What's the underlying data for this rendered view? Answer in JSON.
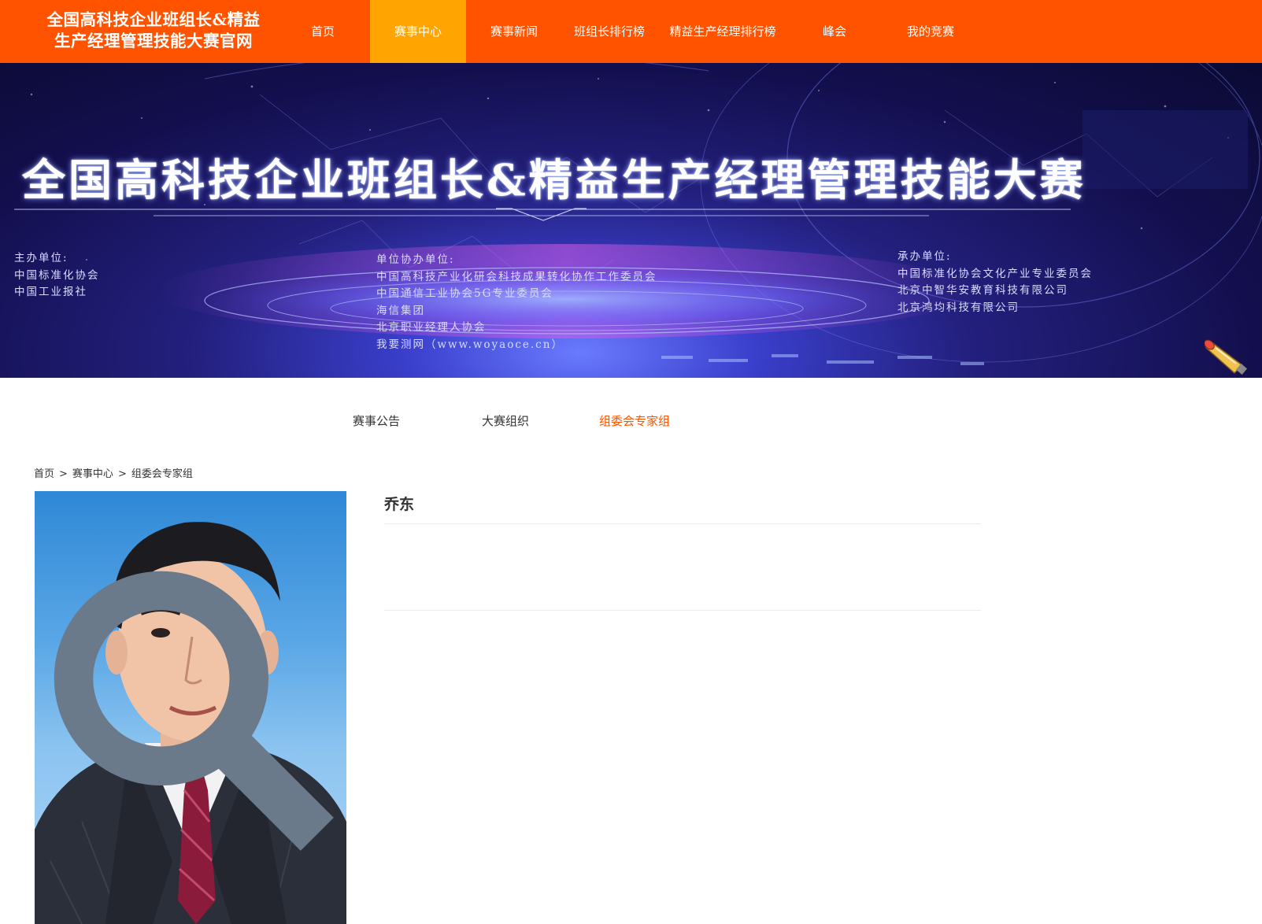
{
  "site": {
    "logo_line1": "全国高科技企业班组长&精益",
    "logo_line2": "生产经理管理技能大赛官网"
  },
  "nav": {
    "items": [
      {
        "label": "首页",
        "active": false
      },
      {
        "label": "赛事中心",
        "active": true
      },
      {
        "label": "赛事新闻",
        "active": false
      },
      {
        "label": "班组长排行榜",
        "active": false
      },
      {
        "label": "精益生产经理排行榜",
        "active": false
      },
      {
        "label": "峰会",
        "active": false
      },
      {
        "label": "我的竞赛",
        "active": false
      }
    ]
  },
  "banner": {
    "title": "全国高科技企业班组长&精益生产经理管理技能大赛",
    "host": [
      "主办单位:",
      "中国标准化协会",
      "中国工业报社"
    ],
    "co_organizers": [
      "单位协办单位:",
      "中国高科技产业化研会科技成果转化协作工作委员会",
      "中国通信工业协会5G专业委员会",
      "海信集团",
      "北京职业经理人协会",
      "我要测网（www.woyaoce.cn）"
    ],
    "undertakers": [
      "承办单位:",
      "中国标准化协会文化产业专业委员会",
      "北京中智华安教育科技有限公司",
      "北京鸿均科技有限公司"
    ]
  },
  "subtabs": [
    {
      "label": "赛事公告",
      "active": false
    },
    {
      "label": "大赛组织",
      "active": false
    },
    {
      "label": "组委会专家组",
      "active": true
    }
  ],
  "breadcrumb": [
    "首页",
    "赛事中心",
    "组委会专家组"
  ],
  "breadcrumb_separator": ">",
  "person": {
    "name": "乔东"
  },
  "colors": {
    "brand": "#ff5300",
    "nav_active": "#ffa400",
    "subtab_active": "#ff5300"
  },
  "icons": {
    "zoom": "magnifier-icon",
    "horn": "megaphone-icon"
  }
}
